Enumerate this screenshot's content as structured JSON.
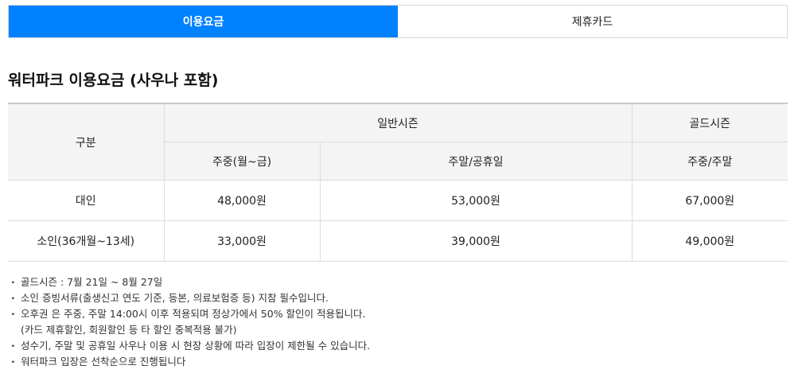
{
  "tabs": [
    {
      "label": "이용요금",
      "active": true
    },
    {
      "label": "제휴카드",
      "active": false
    }
  ],
  "section_title": "워터파크 이용요금 (사우나 포함)",
  "table": {
    "header_category": "구분",
    "header_regular_season": "일반시즌",
    "header_gold_season": "골드시즌",
    "header_weekday": "주중(월~금)",
    "header_weekend_holiday": "주말/공휴일",
    "header_weekday_weekend": "주중/주말",
    "rows": [
      {
        "category": "대인",
        "weekday": "48,000원",
        "weekend": "53,000원",
        "gold": "67,000원"
      },
      {
        "category": "소인(36개월~13세)",
        "weekday": "33,000원",
        "weekend": "39,000원",
        "gold": "49,000원"
      }
    ]
  },
  "notes": [
    {
      "text": "골드시즌 : 7월 21일 ~ 8월 27일"
    },
    {
      "text": "소인 증빙서류(출생신고 연도 기준, 등본, 의료보험증 등) 지참 필수입니다."
    },
    {
      "text": "오후권 은 주중, 주말 14:00시 이후 적용되며 정상가에서 50% 할인이 적용됩니다.",
      "sub": "(카드 제휴할인, 회원할인 등 타 할인 중복적용 불가)"
    },
    {
      "text": "성수기, 주말 및 공휴일 사우나 이용 시 현장 상황에 따라 입장이 제한될 수 있습니다."
    },
    {
      "text": "워터파크 입장은 선착순으로 진행됩니다"
    }
  ],
  "colors": {
    "accent": "#0081ff",
    "header_bg": "#f4f4f4",
    "border": "#dcdcdc"
  }
}
